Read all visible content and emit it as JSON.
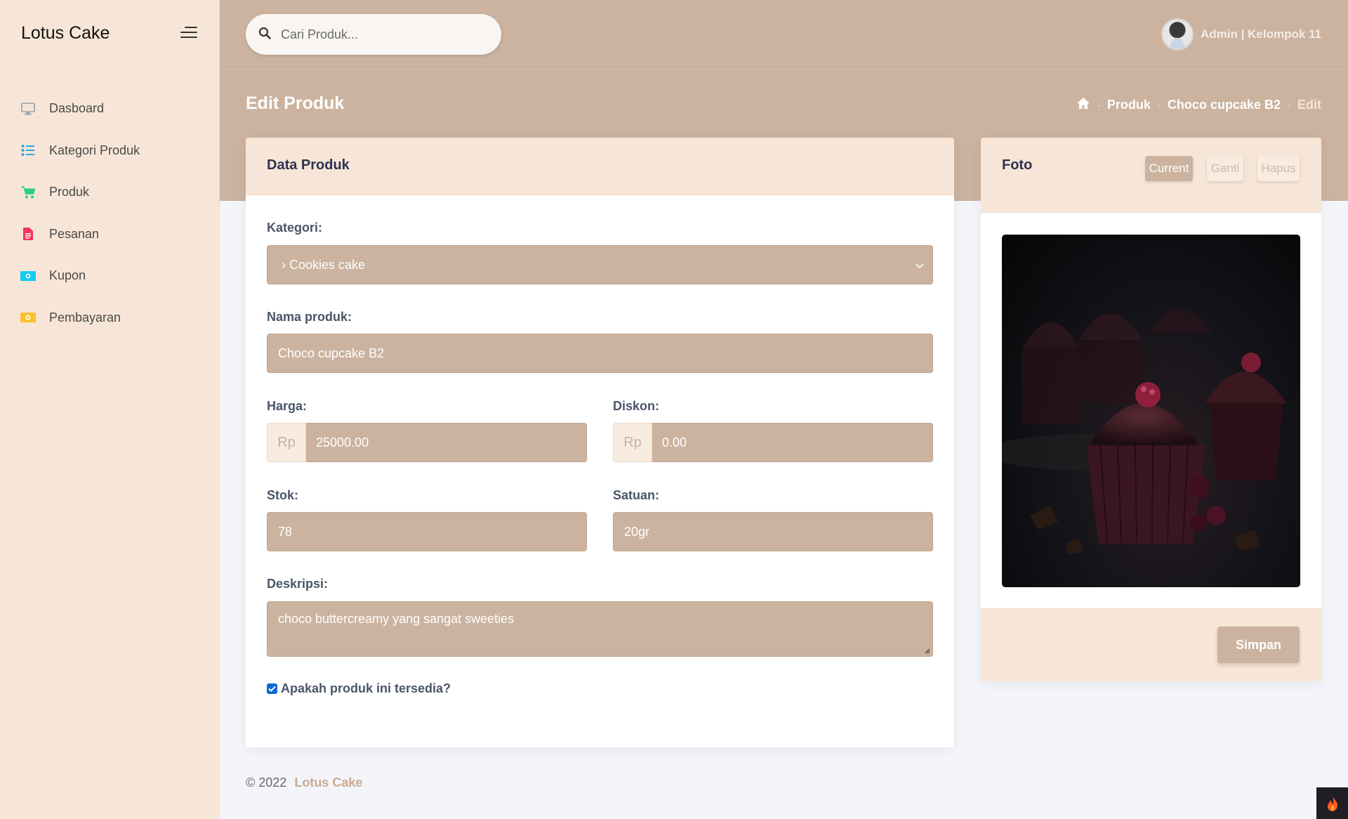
{
  "app": {
    "brand": "Lotus Cake"
  },
  "sidebar": {
    "items": [
      {
        "label": "Dasboard",
        "icon": "monitor-icon",
        "color": "#9aa0a6"
      },
      {
        "label": "Kategori Produk",
        "icon": "list-icon",
        "color": "#2ea7e0"
      },
      {
        "label": "Produk",
        "icon": "cart-icon",
        "color": "#2dce89"
      },
      {
        "label": "Pesanan",
        "icon": "document-icon",
        "color": "#f5365c"
      },
      {
        "label": "Kupon",
        "icon": "money-icon",
        "color": "#11cdef"
      },
      {
        "label": "Pembayaran",
        "icon": "money-icon",
        "color": "#fbc02d"
      }
    ]
  },
  "search": {
    "placeholder": "Cari Produk..."
  },
  "user": {
    "name": "Admin | Kelompok 11"
  },
  "header": {
    "title": "Edit Produk"
  },
  "breadcrumb": {
    "items": [
      "Produk",
      "Choco cupcake B2",
      "Edit"
    ]
  },
  "form": {
    "title": "Data Produk",
    "kategori": {
      "label": "Kategori:",
      "value": "› Cookies cake"
    },
    "nama": {
      "label": "Nama produk:",
      "value": "Choco cupcake B2"
    },
    "harga": {
      "label": "Harga:",
      "prefix": "Rp",
      "value": "25000.00"
    },
    "diskon": {
      "label": "Diskon:",
      "prefix": "Rp",
      "value": "0.00"
    },
    "stok": {
      "label": "Stok:",
      "value": "78"
    },
    "satuan": {
      "label": "Satuan:",
      "value": "20gr"
    },
    "deskripsi": {
      "label": "Deskripsi:",
      "value": "choco buttercreamy yang sangat sweeties"
    },
    "tersedia": {
      "label": "Apakah produk ini tersedia?",
      "checked": true
    }
  },
  "photo": {
    "title": "Foto",
    "tabs": [
      "Current",
      "Ganti",
      "Hapus"
    ],
    "save_label": "Simpan"
  },
  "footer": {
    "copyright": "© 2022",
    "brand": "Lotus Cake"
  },
  "colors": {
    "accent": "#cbb39f",
    "sidebar": "#f7e6d7",
    "background": "#f4f5fa"
  }
}
